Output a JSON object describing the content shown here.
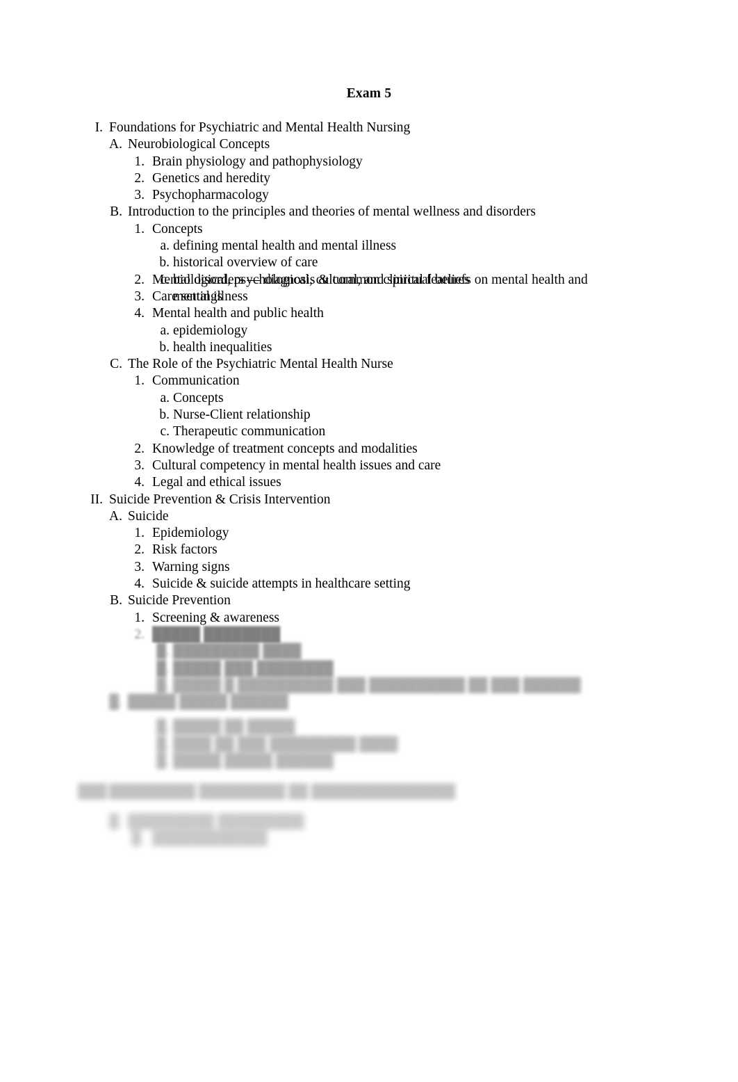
{
  "document": {
    "title": "Exam 5",
    "page_background": "#ffffff",
    "text_color": "#000000"
  },
  "outline": [
    {
      "level": "roman",
      "marker": "I.",
      "text": "Foundations for Psychiatric and Mental Health Nursing",
      "blur": 0
    },
    {
      "level": "alpha",
      "marker": "A.",
      "text": "Neurobiological Concepts",
      "blur": 0
    },
    {
      "level": "num",
      "marker": "1.",
      "text": "Brain physiology and pathophysiology",
      "blur": 0
    },
    {
      "level": "num",
      "marker": "2.",
      "text": "Genetics and heredity",
      "blur": 0
    },
    {
      "level": "num",
      "marker": "3.",
      "text": "Psychopharmacology",
      "blur": 0
    },
    {
      "level": "alpha",
      "marker": "B.",
      "text": "Introduction to the principles and theories of mental wellness and disorders",
      "blur": 0
    },
    {
      "level": "num",
      "marker": "1.",
      "text": "Concepts",
      "blur": 0
    },
    {
      "level": "lower",
      "marker": "a.",
      "text": "defining mental health and mental illness",
      "blur": 0
    },
    {
      "level": "lower",
      "marker": "b.",
      "text": "historical overview of care",
      "blur": 0
    },
    {
      "level": "lower",
      "marker": "c.",
      "text": "biological, psychological, cultural, and spiritual beliefs on mental health and mental illness",
      "blur": 0,
      "wrap": true
    },
    {
      "level": "num",
      "marker": "2.",
      "text": "Mental disorders — diagnosis & common clinical features",
      "blur": 0
    },
    {
      "level": "num",
      "marker": "3.",
      "text": "Care settings",
      "blur": 0
    },
    {
      "level": "num",
      "marker": "4.",
      "text": "Mental health and public health",
      "blur": 0
    },
    {
      "level": "lower",
      "marker": "a.",
      "text": "epidemiology",
      "blur": 0
    },
    {
      "level": "lower",
      "marker": "b.",
      "text": "health inequalities",
      "blur": 0
    },
    {
      "level": "alpha",
      "marker": "C.",
      "text": "The Role of the Psychiatric Mental Health Nurse",
      "blur": 0
    },
    {
      "level": "num",
      "marker": "1.",
      "text": "Communication",
      "blur": 0
    },
    {
      "level": "lower",
      "marker": "a.",
      "text": "Concepts",
      "blur": 0
    },
    {
      "level": "lower",
      "marker": "b.",
      "text": "Nurse-Client relationship",
      "blur": 0
    },
    {
      "level": "lower",
      "marker": "c.",
      "text": "Therapeutic communication",
      "blur": 0
    },
    {
      "level": "num",
      "marker": "2.",
      "text": "Knowledge of treatment concepts and modalities",
      "blur": 0
    },
    {
      "level": "num",
      "marker": "3.",
      "text": "Cultural competency in mental health issues and care",
      "blur": 0
    },
    {
      "level": "num",
      "marker": "4.",
      "text": "Legal and ethical issues",
      "blur": 0
    },
    {
      "level": "roman",
      "marker": "II.",
      "text": "Suicide Prevention & Crisis Intervention",
      "blur": 0
    },
    {
      "level": "alpha",
      "marker": "A.",
      "text": "Suicide",
      "blur": 0
    },
    {
      "level": "num",
      "marker": "1.",
      "text": "Epidemiology",
      "blur": 0
    },
    {
      "level": "num",
      "marker": "2.",
      "text": "Risk factors",
      "blur": 0
    },
    {
      "level": "num",
      "marker": "3.",
      "text": "Warning signs",
      "blur": 0
    },
    {
      "level": "num",
      "marker": "4.",
      "text": "Suicide & suicide attempts in healthcare setting",
      "blur": 0
    },
    {
      "level": "alpha",
      "marker": "B.",
      "text": "Suicide Prevention",
      "blur": 0
    },
    {
      "level": "num",
      "marker": "1.",
      "text": "Screening & awareness",
      "blur": 0
    },
    {
      "level": "num",
      "marker": "2.",
      "text": "█████ ████████",
      "blur": 1,
      "marker_sharp": true
    },
    {
      "level": "lower",
      "marker": "█.",
      "text": "█████████ ████",
      "blur": 2
    },
    {
      "level": "lower",
      "marker": "█.",
      "text": "█████ ███ ████████",
      "blur": 2
    },
    {
      "level": "lower",
      "marker": "█.",
      "text": "█████ █ ██████████ ███ ██████████ ██ ███ ██████",
      "blur": 3
    },
    {
      "level": "alpha",
      "marker": "█.",
      "text": "█████ █████ ██████",
      "blur": 3
    },
    {
      "level": "lower",
      "marker": "█.",
      "text": "█████ ██ █████",
      "blur": 4
    },
    {
      "level": "lower",
      "marker": "█.",
      "text": "████ ██ ███ █████████ ████",
      "blur": 4
    },
    {
      "level": "lower",
      "marker": "█.",
      "text": "█████ █████ ██████",
      "blur": 4
    },
    {
      "level": "roman",
      "marker": "███.",
      "text": "█████████ █████████ ██ ███████████████",
      "blur": 5
    },
    {
      "level": "alpha",
      "marker": "█.",
      "text": "█████████ █████████",
      "blur": 6
    },
    {
      "level": "num",
      "marker": "█.",
      "text": "████████████",
      "blur": 6
    }
  ]
}
